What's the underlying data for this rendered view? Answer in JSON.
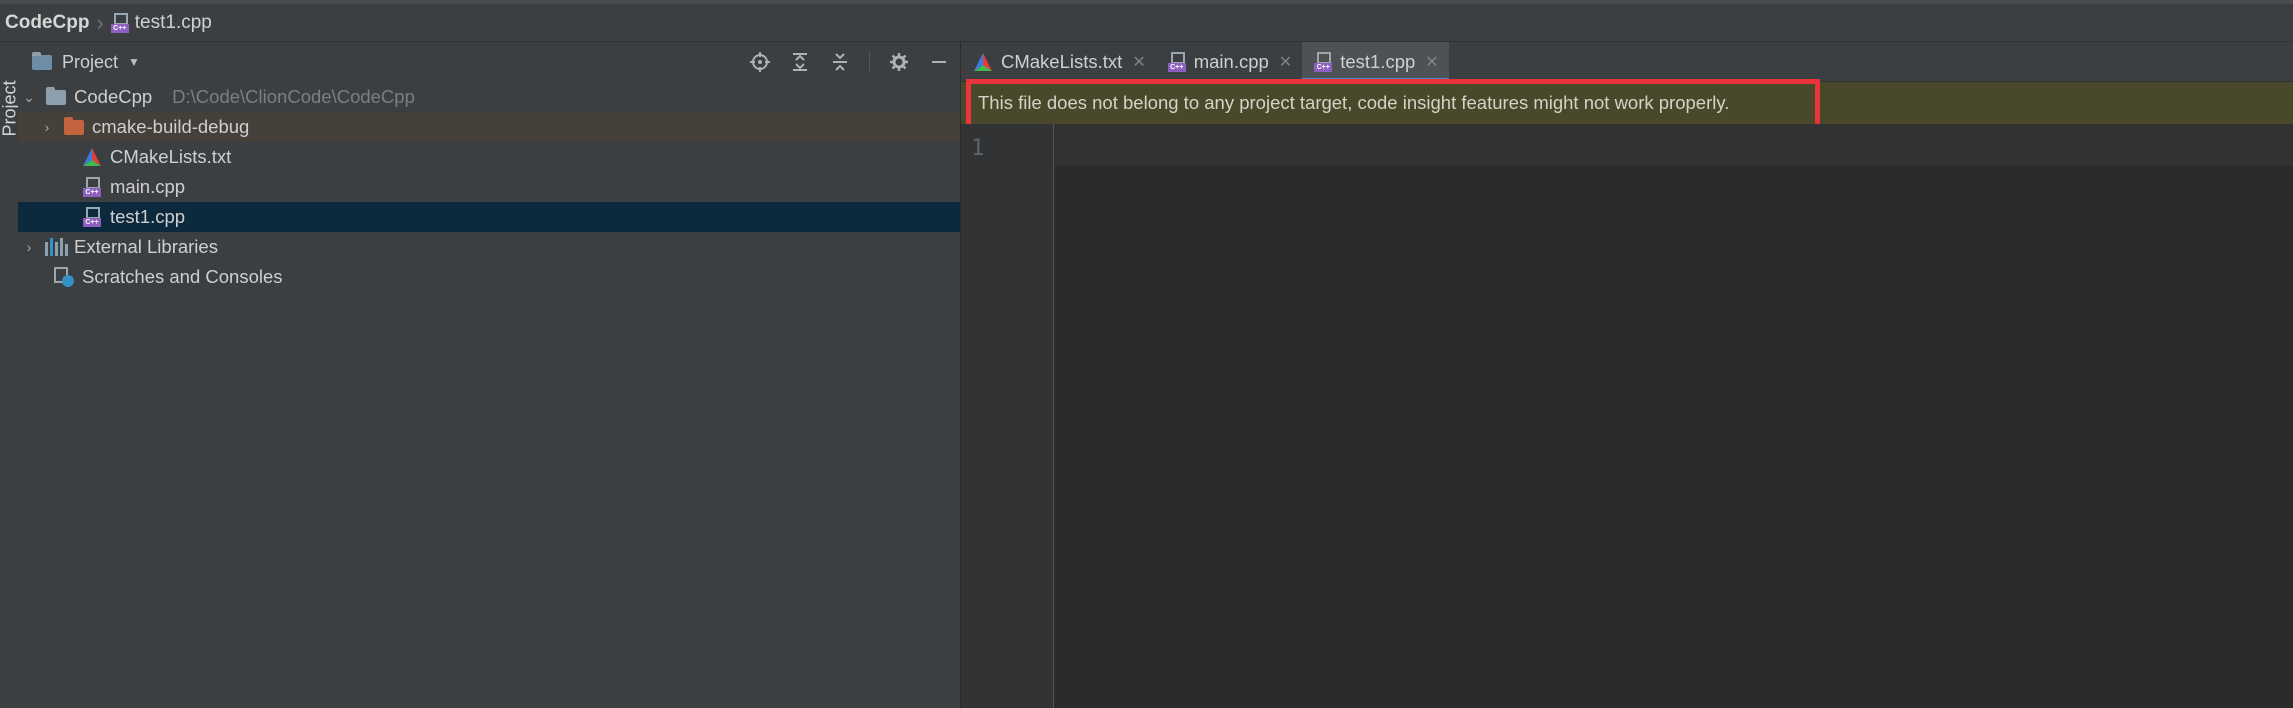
{
  "navbar": {
    "project": "CodeCpp",
    "file": "test1.cpp"
  },
  "left_strip": {
    "label": "Project"
  },
  "project_panel": {
    "title": "Project",
    "tree": [
      {
        "label": "CodeCpp",
        "path": "D:\\Code\\ClionCode\\CodeCpp",
        "icon": "folder-icon",
        "expanded": true
      },
      {
        "label": "cmake-build-debug",
        "icon": "folder-orange-icon"
      },
      {
        "label": "CMakeLists.txt",
        "icon": "cmake-icon"
      },
      {
        "label": "main.cpp",
        "icon": "cpp-file-icon"
      },
      {
        "label": "test1.cpp",
        "icon": "cpp-file-icon",
        "selected": true
      },
      {
        "label": "External Libraries",
        "icon": "library-icon"
      },
      {
        "label": "Scratches and Consoles",
        "icon": "scratch-icon"
      }
    ]
  },
  "tabs": [
    {
      "label": "CMakeLists.txt",
      "icon": "cmake-icon"
    },
    {
      "label": "main.cpp",
      "icon": "cpp-file-icon"
    },
    {
      "label": "test1.cpp",
      "icon": "cpp-file-icon",
      "active": true
    }
  ],
  "banner": {
    "message": "This file does not belong to any project target, code insight features might not work properly."
  },
  "editor": {
    "line_numbers": [
      "1"
    ]
  },
  "colors": {
    "banner_bg": "#49482b",
    "highlight_box": "#e8343a",
    "selection": "#0d293e"
  }
}
